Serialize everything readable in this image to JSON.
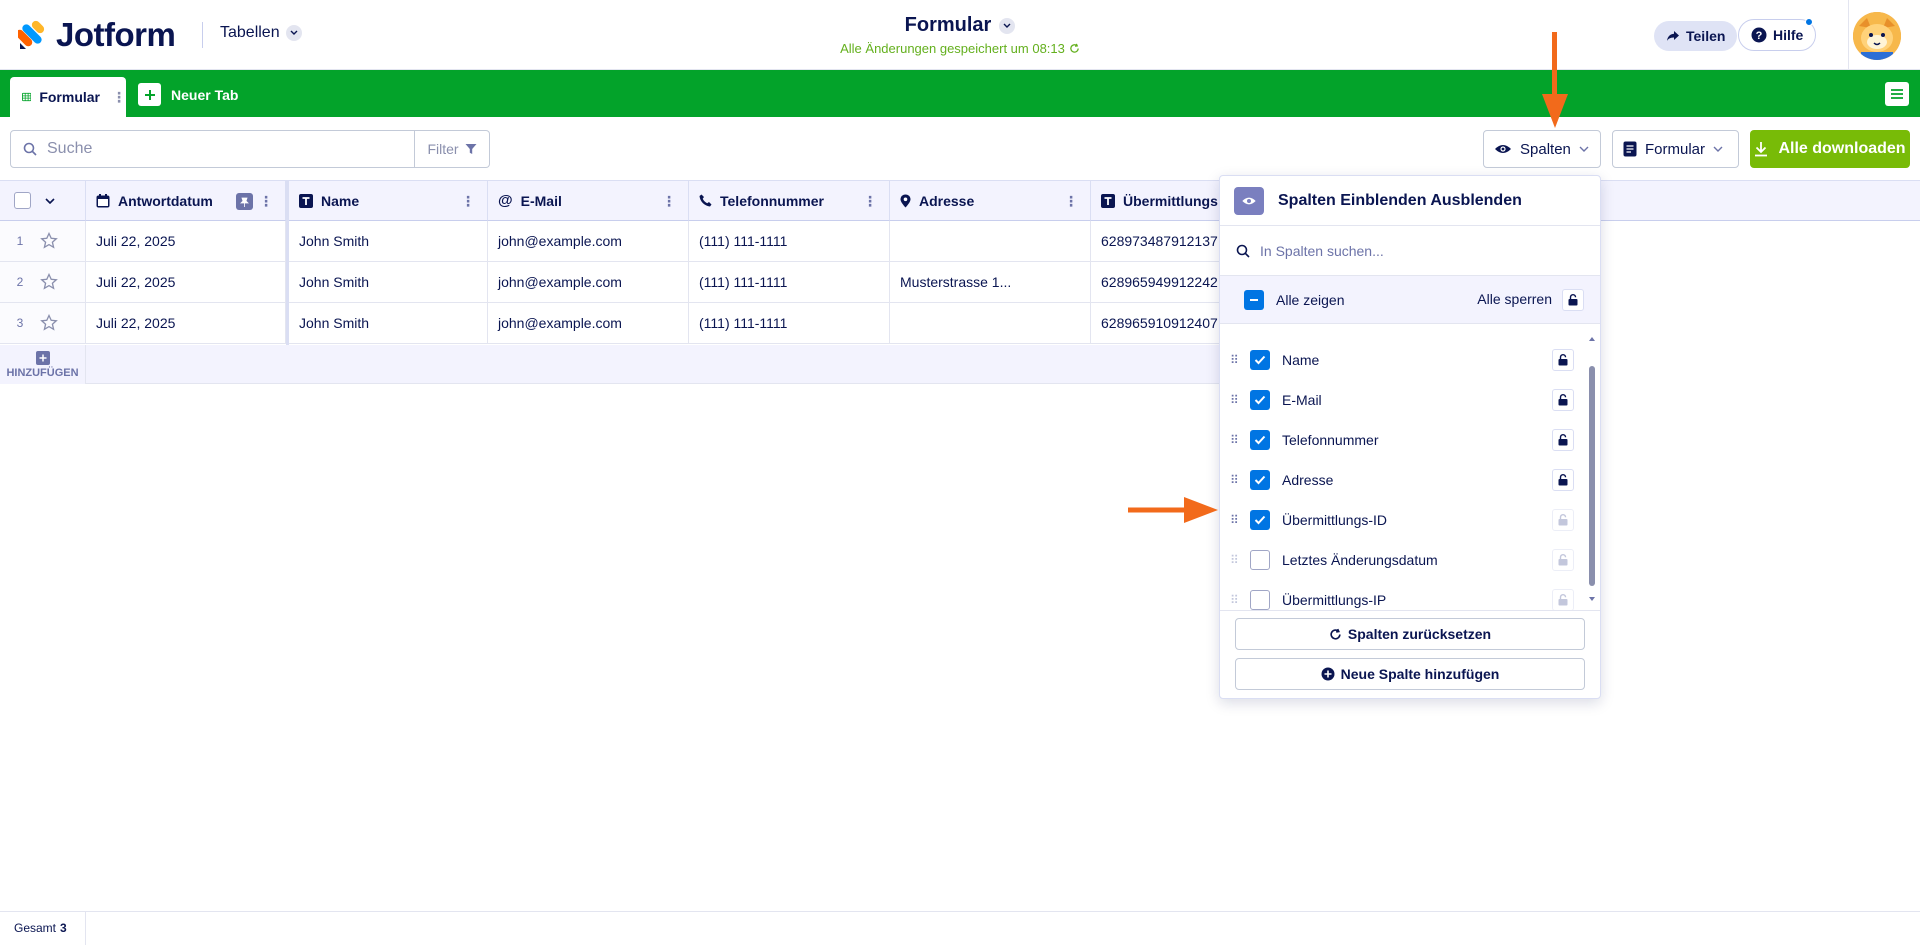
{
  "header": {
    "brand": "Jotform",
    "switcher_label": "Tabellen",
    "form_title": "Formular",
    "save_status": "Alle Änderungen gespeichert um 08:13",
    "share_label": "Teilen",
    "help_label": "Hilfe"
  },
  "tabs": {
    "active_label": "Formular",
    "new_tab_label": "Neuer Tab"
  },
  "toolbar": {
    "search_placeholder": "Suche",
    "filter_label": "Filter",
    "columns_label": "Spalten",
    "form_label": "Formular",
    "download_label": "Alle downloaden"
  },
  "table": {
    "columns": [
      {
        "label": "Antwortdatum",
        "icon": "calendar-icon"
      },
      {
        "label": "Name",
        "icon": "text-icon"
      },
      {
        "label": "E-Mail",
        "icon": "at-icon"
      },
      {
        "label": "Telefonnummer",
        "icon": "phone-icon"
      },
      {
        "label": "Adresse",
        "icon": "pin-icon"
      },
      {
        "label": "Übermittlungs",
        "icon": "text-icon"
      }
    ],
    "rows": [
      {
        "num": "1",
        "date": "Juli 22, 2025",
        "name": "John Smith",
        "email": "john@example.com",
        "phone": "(111) 111-1111",
        "address": "",
        "id": "628973487912137"
      },
      {
        "num": "2",
        "date": "Juli 22, 2025",
        "name": "John Smith",
        "email": "john@example.com",
        "phone": "(111) 111-1111",
        "address": "Musterstrasse 1...",
        "id": "628965949912242"
      },
      {
        "num": "3",
        "date": "Juli 22, 2025",
        "name": "John Smith",
        "email": "john@example.com",
        "phone": "(111) 111-1111",
        "address": "",
        "id": "628965910912407"
      }
    ],
    "add_label": "HINZUFÜGEN"
  },
  "footer": {
    "total_label": "Gesamt",
    "total_value": "3"
  },
  "columns_panel": {
    "title": "Spalten Einblenden Ausblenden",
    "search_placeholder": "In Spalten suchen...",
    "show_all_label": "Alle zeigen",
    "lock_all_label": "Alle sperren",
    "items": [
      {
        "label": "Name",
        "checked": true
      },
      {
        "label": "E-Mail",
        "checked": true
      },
      {
        "label": "Telefonnummer",
        "checked": true
      },
      {
        "label": "Adresse",
        "checked": true
      },
      {
        "label": "Übermittlungs-ID",
        "checked": true
      },
      {
        "label": "Letztes Änderungsdatum",
        "checked": false
      },
      {
        "label": "Übermittlungs-IP",
        "checked": false
      }
    ],
    "reset_label": "Spalten zurücksetzen",
    "add_label": "Neue Spalte hinzufügen"
  },
  "colors": {
    "tabbar": "#03a32a",
    "download": "#78bb07",
    "checkbox": "#0075e3",
    "annotation_arrow": "#f26a1b"
  }
}
